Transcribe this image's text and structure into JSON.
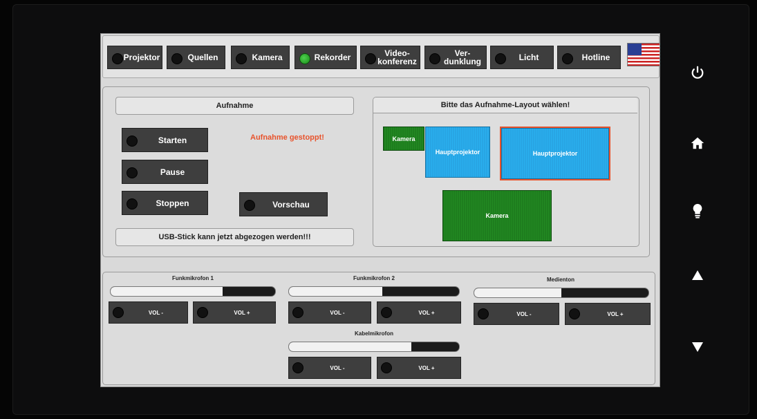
{
  "tabs": [
    {
      "label": "Projektor",
      "active": false
    },
    {
      "label": "Quellen",
      "active": false
    },
    {
      "label": "Kamera",
      "active": false
    },
    {
      "label": "Rekorder",
      "active": true
    },
    {
      "label": "Video-\nkonferenz",
      "active": false
    },
    {
      "label": "Ver-\ndunklung",
      "active": false
    },
    {
      "label": "Licht",
      "active": false
    },
    {
      "label": "Hotline",
      "active": false
    }
  ],
  "recording": {
    "title": "Aufnahme",
    "status": "Aufnahme gestoppt!",
    "start_label": "Starten",
    "pause_label": "Pause",
    "stop_label": "Stoppen",
    "preview_label": "Vorschau",
    "usb_message": "USB-Stick kann jetzt abgezogen werden!!!"
  },
  "layout": {
    "title": "Bitte das Aufnahme-Layout wählen!",
    "option1_cam": "Kamera",
    "option1_proj": "Hauptprojektor",
    "option2_proj": "Hauptprojektor",
    "option3_cam": "Kamera"
  },
  "audio": {
    "ch1": {
      "name": "Funkmikrofon 1",
      "level": 0.68,
      "minus": "VOL -",
      "plus": "VOL +"
    },
    "ch2": {
      "name": "Funkmikrofon 2",
      "level": 0.55,
      "minus": "VOL -",
      "plus": "VOL +"
    },
    "ch3": {
      "name": "Medienton",
      "level": 0.5,
      "minus": "VOL -",
      "plus": "VOL +"
    },
    "ch4": {
      "name": "Kabelmikrofon",
      "level": 0.72,
      "minus": "VOL -",
      "plus": "VOL +"
    }
  },
  "colors": {
    "accent_status": "#e8532c",
    "led_on": "#2aa52a",
    "layout_green": "#228a22",
    "layout_blue": "#2ab0ef"
  },
  "side_icons": [
    "power-icon",
    "home-icon",
    "bulb-icon",
    "arrow-up-icon",
    "arrow-down-icon"
  ]
}
